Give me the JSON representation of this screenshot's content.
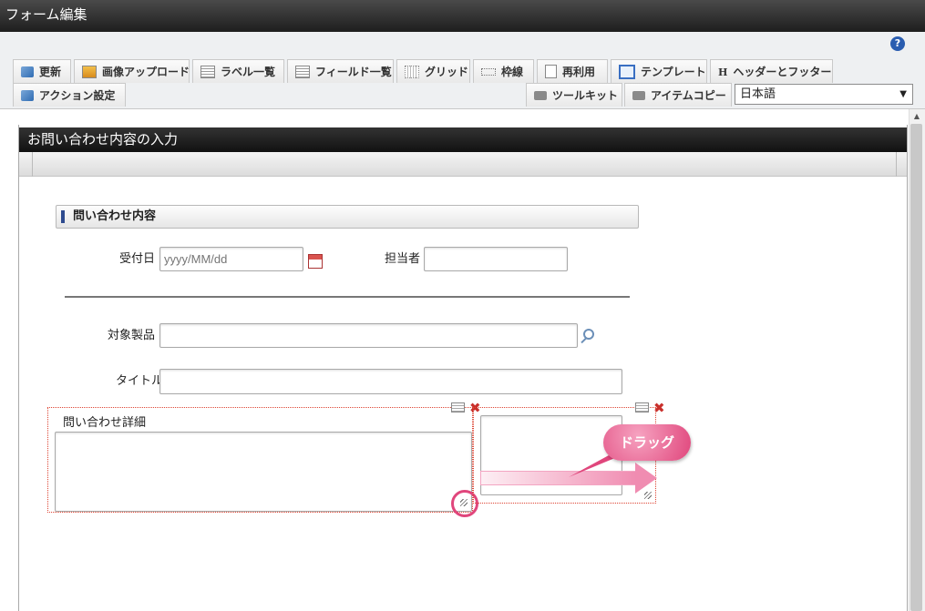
{
  "window": {
    "title": "フォーム編集"
  },
  "toolbar": {
    "help_label": "?",
    "row1": [
      {
        "label": "更新",
        "icon": "refresh-icon"
      },
      {
        "label": "画像アップロード",
        "icon": "image-upload-icon"
      },
      {
        "label": "ラベル一覧",
        "icon": "label-list-icon"
      },
      {
        "label": "フィールド一覧",
        "icon": "field-list-icon"
      },
      {
        "label": "グリッド",
        "icon": "grid-icon"
      },
      {
        "label": "枠線",
        "icon": "border-icon"
      },
      {
        "label": "再利用",
        "icon": "reuse-icon"
      },
      {
        "label": "テンプレート",
        "icon": "template-icon"
      },
      {
        "label": "ヘッダーとフッター",
        "icon": "header-footer-icon"
      }
    ],
    "action": {
      "label": "アクション設定",
      "icon": "action-icon"
    },
    "toolkit": {
      "label": "ツールキット",
      "icon": "toolkit-icon"
    },
    "item_copy": {
      "label": "アイテムコピー",
      "icon": "item-copy-icon"
    },
    "language": {
      "selected": "日本語"
    }
  },
  "form": {
    "header_title": "お問い合わせ内容の入力",
    "section_title": "問い合わせ内容",
    "fields": {
      "reception_date": {
        "label": "受付日",
        "placeholder": "yyyy/MM/dd"
      },
      "assignee": {
        "label": "担当者",
        "placeholder": ""
      },
      "target_product": {
        "label": "対象製品",
        "placeholder": ""
      },
      "title": {
        "label": "タイトル",
        "placeholder": ""
      },
      "inquiry_detail": {
        "label": "問い合わせ詳細",
        "placeholder": ""
      }
    }
  },
  "annotation": {
    "drag_label": "ドラッグ",
    "accent_color": "#e0467c"
  },
  "colors": {
    "titlebar": "#2b2b2b",
    "section_marker": "#2e4b8f",
    "delete_red": "#c9302c"
  }
}
